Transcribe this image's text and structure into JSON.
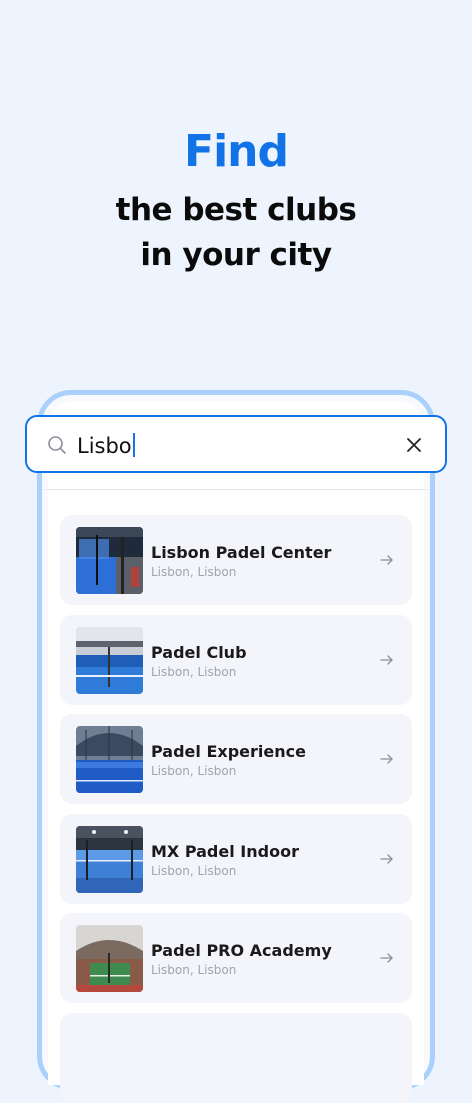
{
  "headline": {
    "accent": "Find",
    "line1": "the best clubs",
    "line2": "in your city"
  },
  "search": {
    "value": "Lisbo",
    "icon": "search-icon",
    "clear_icon": "close-icon"
  },
  "clubs": [
    {
      "name": "Lisbon Padel Center",
      "location": "Lisbon, Lisbon"
    },
    {
      "name": "Padel Club",
      "location": "Lisbon, Lisbon"
    },
    {
      "name": "Padel Experience",
      "location": "Lisbon, Lisbon"
    },
    {
      "name": "MX Padel Indoor",
      "location": "Lisbon, Lisbon"
    },
    {
      "name": "Padel PRO Academy",
      "location": "Lisbon, Lisbon"
    }
  ],
  "colors": {
    "accent": "#1273e6",
    "background": "#eef4fd",
    "phone_border": "#a9d1fb",
    "card": "#f3f5fa"
  }
}
